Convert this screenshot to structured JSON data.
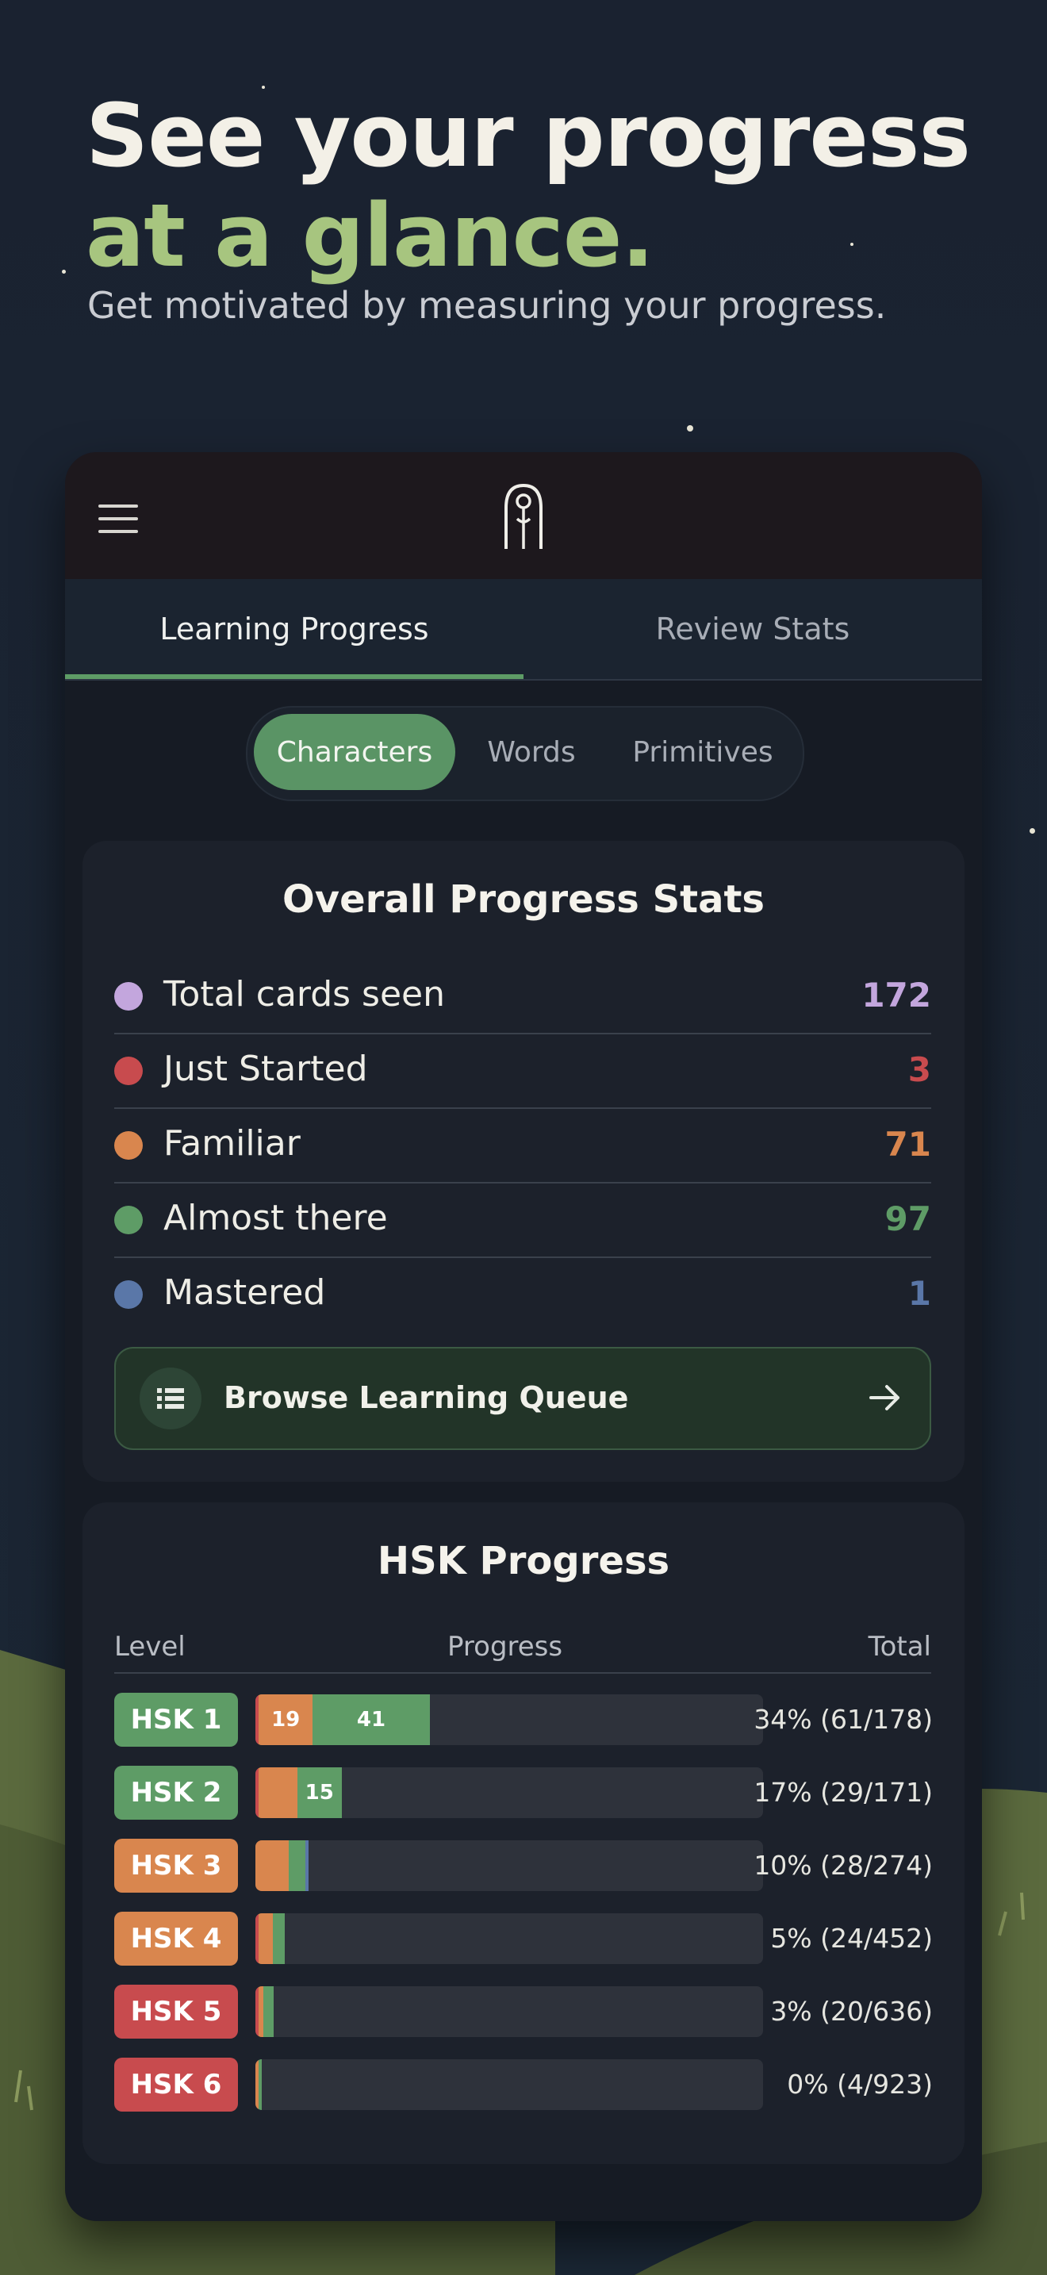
{
  "headline": {
    "line1": "See your progress",
    "line2": "at a glance.",
    "subtitle": "Get motivated by measuring your progress."
  },
  "header": {
    "menu_icon": "hamburger-menu-icon",
    "logo_icon": "app-logo-icon"
  },
  "tabs": [
    {
      "label": "Learning Progress",
      "active": true
    },
    {
      "label": "Review Stats",
      "active": false
    }
  ],
  "segments": [
    {
      "label": "Characters",
      "active": true
    },
    {
      "label": "Words",
      "active": false
    },
    {
      "label": "Primitives",
      "active": false
    }
  ],
  "overall": {
    "title": "Overall Progress Stats",
    "stats": [
      {
        "label": "Total cards seen",
        "value": "172",
        "color": "#c3a6dd"
      },
      {
        "label": "Just Started",
        "value": "3",
        "color": "#c84b4e"
      },
      {
        "label": "Familiar",
        "value": "71",
        "color": "#d9864e"
      },
      {
        "label": "Almost there",
        "value": "97",
        "color": "#5e9c66"
      },
      {
        "label": "Mastered",
        "value": "1",
        "color": "#5a77a8"
      }
    ],
    "queue_button": {
      "label": "Browse Learning Queue",
      "icon": "list-icon",
      "arrow_icon": "arrow-right-icon"
    }
  },
  "hsk": {
    "title": "HSK Progress",
    "columns": {
      "level": "Level",
      "progress": "Progress",
      "total": "Total"
    },
    "colors": {
      "just_started": "#c84b4e",
      "familiar": "#d9864e",
      "almost_there": "#5e9c66",
      "mastered": "#5a77a8"
    },
    "rows": [
      {
        "level": "HSK 1",
        "badge_color": "#5e9c66",
        "total": "34% (61/178)",
        "total_count": 178,
        "just_started": 1,
        "familiar": 19,
        "almost_there": 41,
        "mastered": 0,
        "familiar_label": "19",
        "almost_label": "41"
      },
      {
        "level": "HSK 2",
        "badge_color": "#5e9c66",
        "total": "17% (29/171)",
        "total_count": 171,
        "just_started": 1,
        "familiar": 13,
        "almost_there": 15,
        "mastered": 0,
        "familiar_label": "",
        "almost_label": "15"
      },
      {
        "level": "HSK 3",
        "badge_color": "#d9864e",
        "total": "10% (28/274)",
        "total_count": 274,
        "just_started": 0,
        "familiar": 18,
        "almost_there": 9,
        "mastered": 1,
        "familiar_label": "",
        "almost_label": ""
      },
      {
        "level": "HSK 4",
        "badge_color": "#d9864e",
        "total": "5% (24/452)",
        "total_count": 452,
        "just_started": 1,
        "familiar": 13,
        "almost_there": 10,
        "mastered": 0,
        "familiar_label": "",
        "almost_label": ""
      },
      {
        "level": "HSK 5",
        "badge_color": "#c84b4e",
        "total": "3% (20/636)",
        "total_count": 636,
        "just_started": 1,
        "familiar": 6,
        "almost_there": 13,
        "mastered": 0,
        "familiar_label": "",
        "almost_label": ""
      },
      {
        "level": "HSK 6",
        "badge_color": "#c84b4e",
        "total": "0% (4/923)",
        "total_count": 923,
        "just_started": 0,
        "familiar": 1,
        "almost_there": 3,
        "mastered": 0,
        "familiar_label": "",
        "almost_label": ""
      }
    ]
  }
}
